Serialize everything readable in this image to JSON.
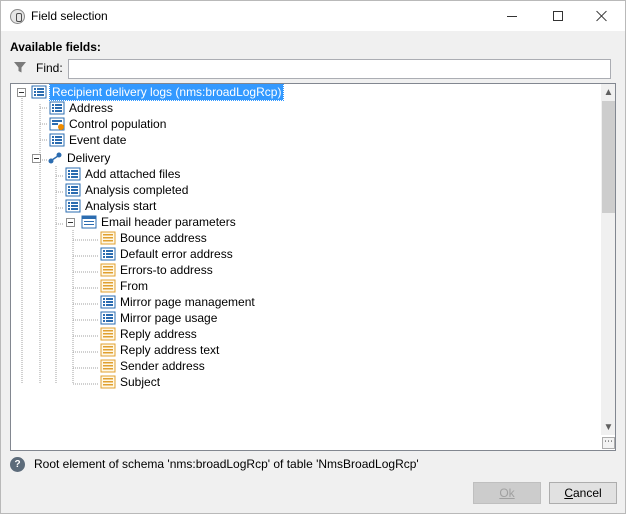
{
  "window": {
    "title": "Field selection"
  },
  "panel": {
    "available_label": "Available fields:"
  },
  "find": {
    "label": "Find:",
    "value": ""
  },
  "tree": {
    "root": "Recipient delivery logs (nms:broadLogRcp)",
    "items": [
      {
        "label": "Address",
        "icon": "attribute-list-icon"
      },
      {
        "label": "Control population",
        "icon": "attribute-flag-icon"
      },
      {
        "label": "Event date",
        "icon": "attribute-list-icon"
      },
      {
        "label": "Delivery",
        "icon": "link-icon"
      },
      {
        "label": "Add attached files",
        "icon": "attribute-list-icon"
      },
      {
        "label": "Analysis completed",
        "icon": "attribute-list-icon"
      },
      {
        "label": "Analysis start",
        "icon": "attribute-list-icon"
      },
      {
        "label": "Email header parameters",
        "icon": "element-icon"
      },
      {
        "label": "Bounce address",
        "icon": "string-attribute-icon"
      },
      {
        "label": "Default error address",
        "icon": "string-attribute-icon"
      },
      {
        "label": "Errors-to address",
        "icon": "string-attribute-icon"
      },
      {
        "label": "From",
        "icon": "string-attribute-icon"
      },
      {
        "label": "Mirror page management",
        "icon": "attribute-list-icon"
      },
      {
        "label": "Mirror page usage",
        "icon": "attribute-list-icon"
      },
      {
        "label": "Reply address",
        "icon": "string-attribute-icon"
      },
      {
        "label": "Reply address text",
        "icon": "string-attribute-icon"
      },
      {
        "label": "Sender address",
        "icon": "string-attribute-icon"
      },
      {
        "label": "Subject",
        "icon": "string-attribute-icon"
      }
    ]
  },
  "status": {
    "text": "Root element of schema 'nms:broadLogRcp' of table 'NmsBroadLogRcp'"
  },
  "buttons": {
    "ok": "Ok",
    "cancel": "Cancel"
  },
  "colors": {
    "selection": "#3399ff",
    "field_icon": "#2b6cb0",
    "string_icon": "#e0a030"
  }
}
